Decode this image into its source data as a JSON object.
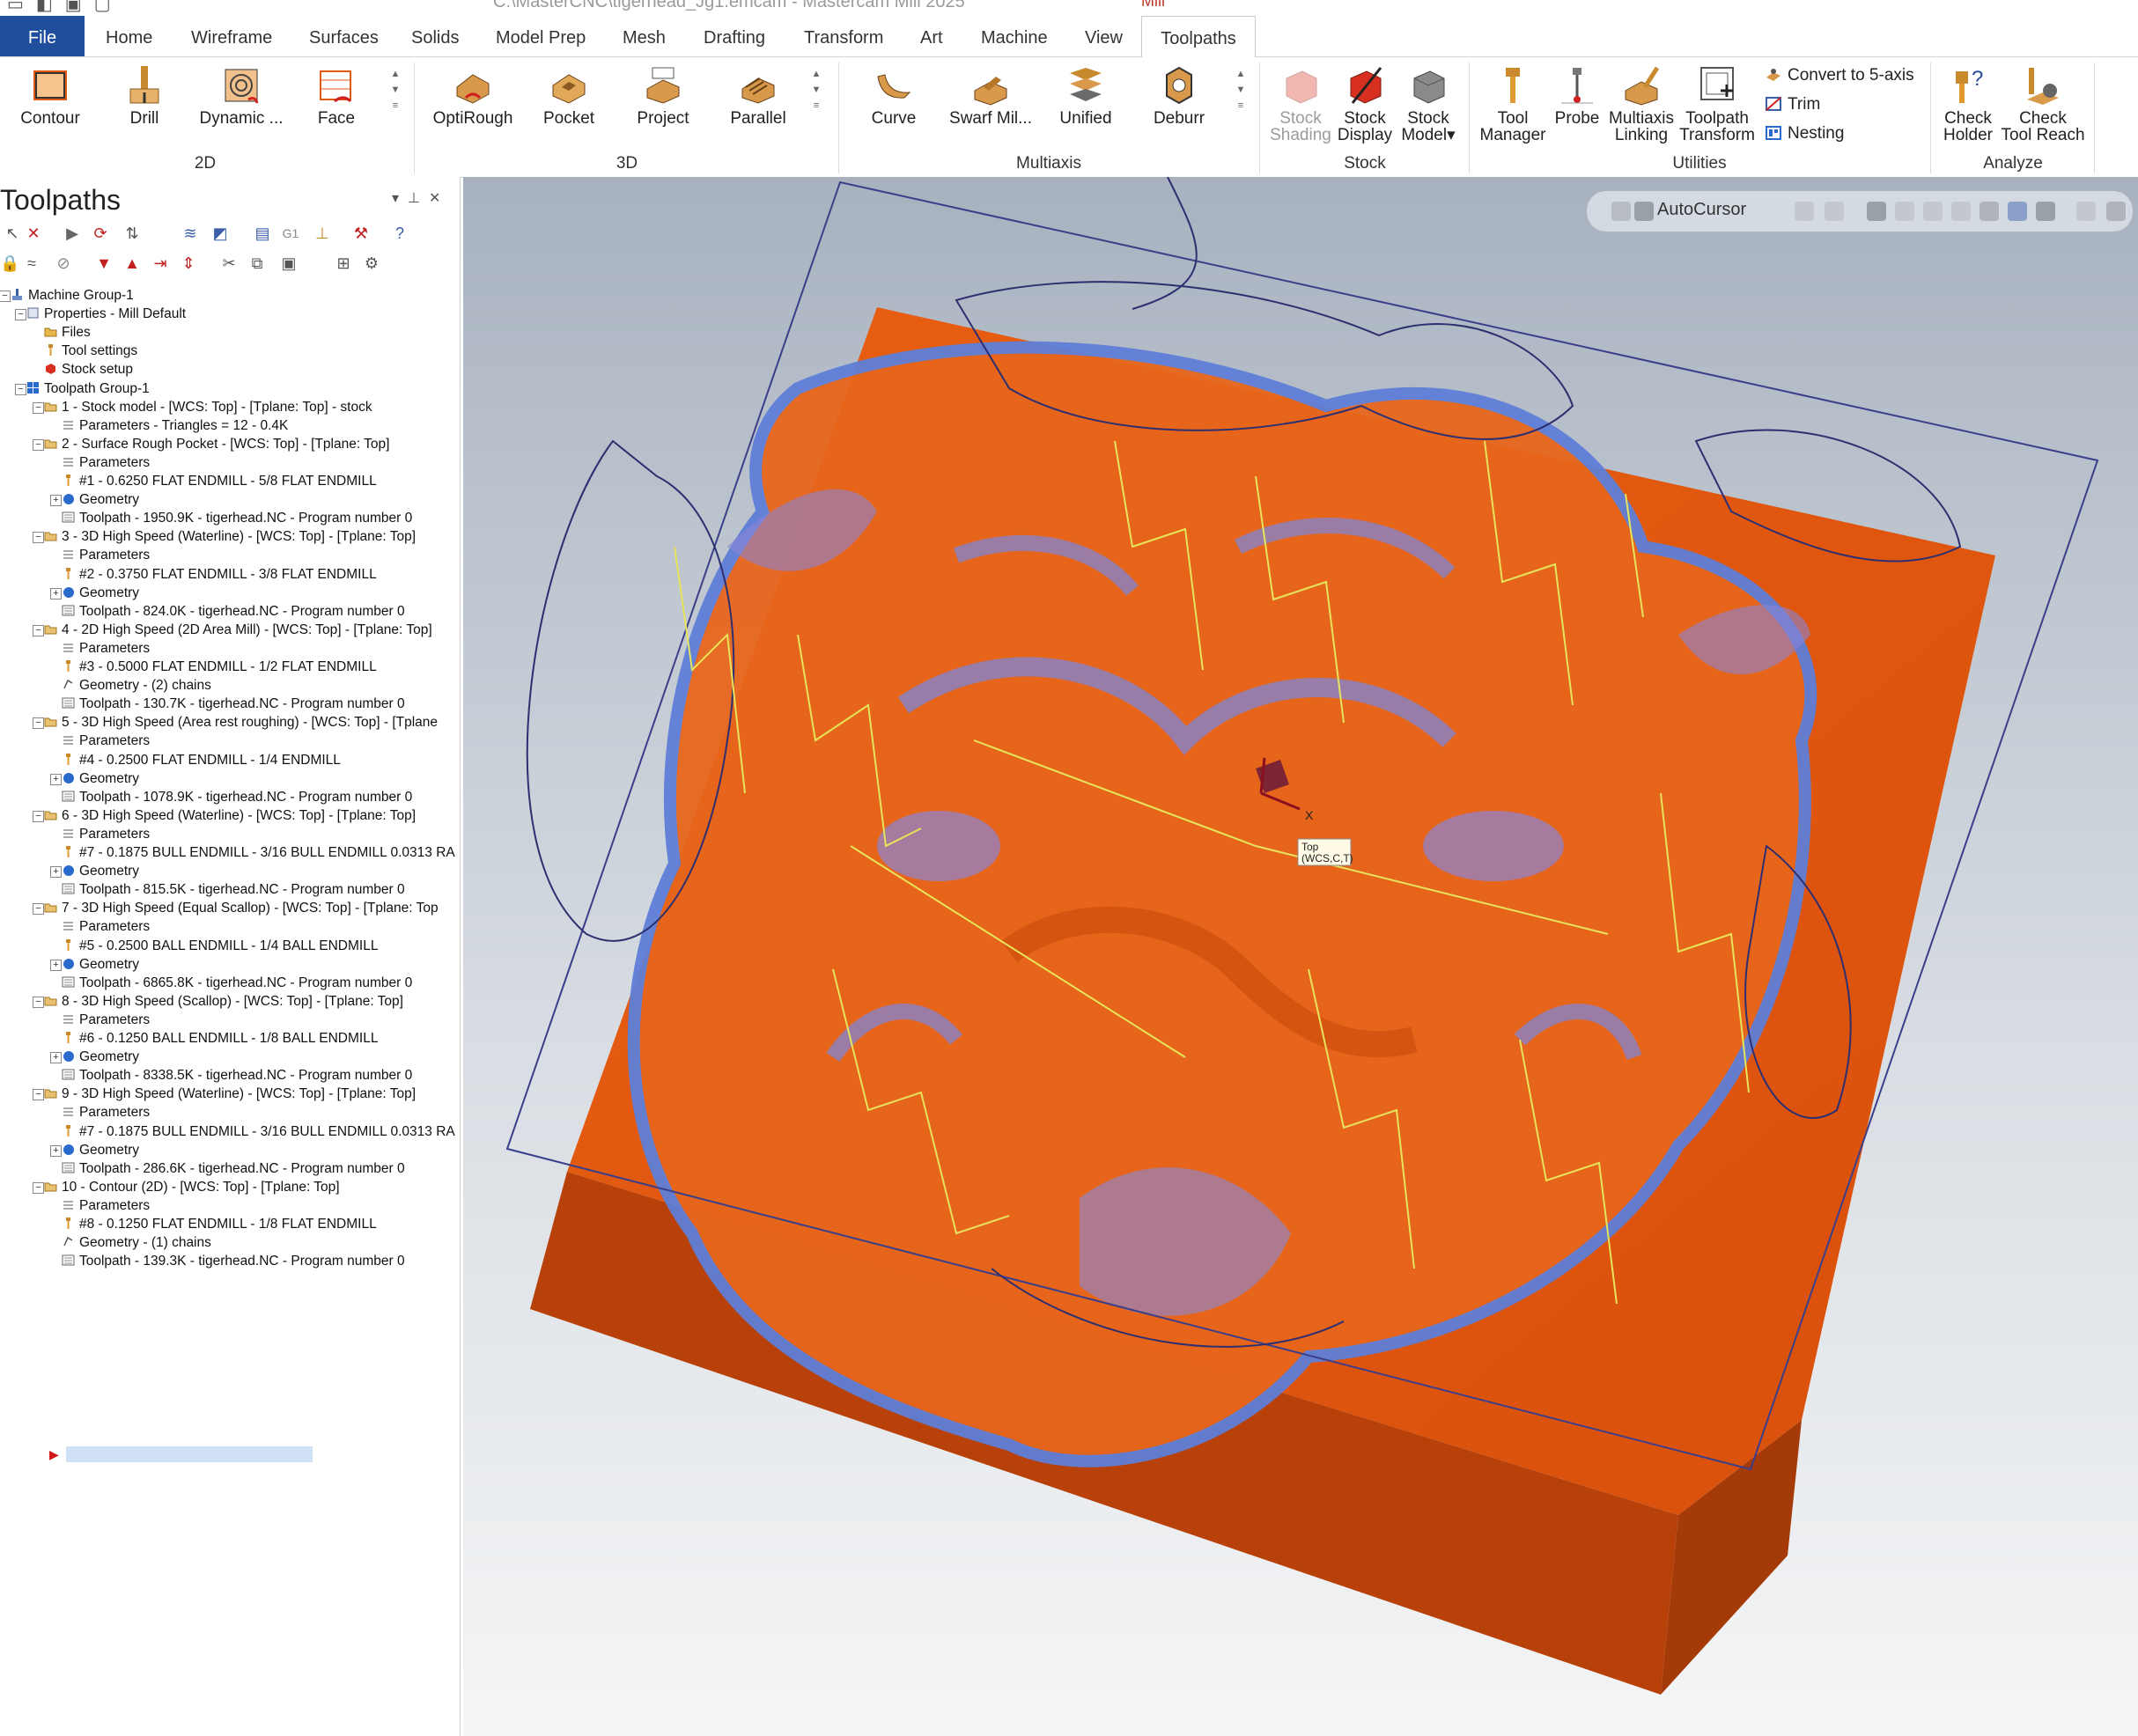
{
  "titlebar": {
    "title": "C:\\MasterCNC\\tigerhead_Jg1.emcam - Mastercam Mill 2025",
    "context_tab": "Mill"
  },
  "tabs": [
    "File",
    "Home",
    "Wireframe",
    "Surfaces",
    "Solids",
    "Model Prep",
    "Mesh",
    "Drafting",
    "Transform",
    "Art",
    "Machine",
    "View",
    "Toolpaths"
  ],
  "active_tab": "Toolpaths",
  "ribbon": {
    "groups": {
      "g2d": "2D",
      "g3d": "3D",
      "gmulti": "Multiaxis",
      "gstock": "Stock",
      "gutil": "Utilities",
      "ganalyze": "Analyze"
    },
    "b2d": [
      "Contour",
      "Drill",
      "Dynamic ...",
      "Face"
    ],
    "b3d": [
      "OptiRough",
      "Pocket",
      "Project",
      "Parallel"
    ],
    "bmulti": [
      "Curve",
      "Swarf Mil...",
      "Unified",
      "Deburr"
    ],
    "stock_shading": [
      "Stock",
      "Shading"
    ],
    "stock_display": [
      "Stock",
      "Display"
    ],
    "stock_model": [
      "Stock",
      "Model"
    ],
    "tool_manager": [
      "Tool",
      "Manager"
    ],
    "probe": "Probe",
    "multiaxis_linking": [
      "Multiaxis",
      "Linking"
    ],
    "toolpath_transform": [
      "Toolpath",
      "Transform"
    ],
    "util_small": [
      "Convert to 5-axis",
      "Trim",
      "Nesting"
    ],
    "check_holder": [
      "Check",
      "Holder"
    ],
    "check_reach": [
      "Check",
      "Tool Reach"
    ]
  },
  "panel": {
    "title": "Toolpaths",
    "tree": [
      {
        "t": "Machine Group-1",
        "lvl": 0,
        "ic": "machine"
      },
      {
        "t": "Properties - Mill Default",
        "lvl": 1,
        "ic": "props"
      },
      {
        "t": "Files",
        "lvl": 2,
        "ic": "folder"
      },
      {
        "t": "Tool settings",
        "lvl": 2,
        "ic": "tool"
      },
      {
        "t": "Stock setup",
        "lvl": 2,
        "ic": "stock"
      },
      {
        "t": "Toolpath Group-1",
        "lvl": 1,
        "ic": "group"
      },
      {
        "t": "1 - Stock model - [WCS: Top] - [Tplane: Top] - stock",
        "lvl": 2,
        "ic": "op"
      },
      {
        "t": "Parameters - Triangles =  12 - 0.4K",
        "lvl": 3,
        "ic": "params"
      },
      {
        "t": "2 - Surface Rough Pocket - [WCS: Top] - [Tplane: Top]",
        "lvl": 2,
        "ic": "op"
      },
      {
        "t": "Parameters",
        "lvl": 3,
        "ic": "params"
      },
      {
        "t": "#1 - 0.6250 FLAT ENDMILL - 5/8 FLAT ENDMILL",
        "lvl": 3,
        "ic": "tool"
      },
      {
        "t": "Geometry",
        "lvl": 3,
        "ic": "geom"
      },
      {
        "t": "Toolpath - 1950.9K - tigerhead.NC - Program number 0",
        "lvl": 3,
        "ic": "tp"
      },
      {
        "t": "3 - 3D High Speed (Waterline) - [WCS: Top] - [Tplane: Top]",
        "lvl": 2,
        "ic": "op"
      },
      {
        "t": "Parameters",
        "lvl": 3,
        "ic": "params"
      },
      {
        "t": "#2 - 0.3750 FLAT ENDMILL - 3/8 FLAT ENDMILL",
        "lvl": 3,
        "ic": "tool"
      },
      {
        "t": "Geometry",
        "lvl": 3,
        "ic": "geom"
      },
      {
        "t": "Toolpath - 824.0K - tigerhead.NC - Program number 0",
        "lvl": 3,
        "ic": "tp"
      },
      {
        "t": "4 - 2D High Speed (2D Area Mill) - [WCS: Top] - [Tplane: Top]",
        "lvl": 2,
        "ic": "op"
      },
      {
        "t": "Parameters",
        "lvl": 3,
        "ic": "params"
      },
      {
        "t": "#3 - 0.5000 FLAT ENDMILL - 1/2 FLAT ENDMILL",
        "lvl": 3,
        "ic": "tool"
      },
      {
        "t": "Geometry - (2) chains",
        "lvl": 3,
        "ic": "chain"
      },
      {
        "t": "Toolpath - 130.7K - tigerhead.NC - Program number 0",
        "lvl": 3,
        "ic": "tp"
      },
      {
        "t": "5 - 3D High Speed (Area rest roughing) - [WCS: Top] - [Tplane",
        "lvl": 2,
        "ic": "op"
      },
      {
        "t": "Parameters",
        "lvl": 3,
        "ic": "params"
      },
      {
        "t": "#4 - 0.2500 FLAT ENDMILL - 1/4 ENDMILL",
        "lvl": 3,
        "ic": "tool"
      },
      {
        "t": "Geometry",
        "lvl": 3,
        "ic": "geom"
      },
      {
        "t": "Toolpath - 1078.9K - tigerhead.NC - Program number 0",
        "lvl": 3,
        "ic": "tp"
      },
      {
        "t": "6 - 3D High Speed (Waterline) - [WCS: Top] - [Tplane: Top]",
        "lvl": 2,
        "ic": "op"
      },
      {
        "t": "Parameters",
        "lvl": 3,
        "ic": "params"
      },
      {
        "t": "#7 - 0.1875 BULL ENDMILL - 3/16 BULL ENDMILL 0.0313 RA",
        "lvl": 3,
        "ic": "tool"
      },
      {
        "t": "Geometry",
        "lvl": 3,
        "ic": "geom"
      },
      {
        "t": "Toolpath - 815.5K - tigerhead.NC - Program number 0",
        "lvl": 3,
        "ic": "tp"
      },
      {
        "t": "7 - 3D High Speed (Equal Scallop) - [WCS: Top] - [Tplane: Top",
        "lvl": 2,
        "ic": "op"
      },
      {
        "t": "Parameters",
        "lvl": 3,
        "ic": "params"
      },
      {
        "t": "#5 - 0.2500 BALL ENDMILL - 1/4 BALL ENDMILL",
        "lvl": 3,
        "ic": "tool"
      },
      {
        "t": "Geometry",
        "lvl": 3,
        "ic": "geom"
      },
      {
        "t": "Toolpath - 6865.8K - tigerhead.NC - Program number 0",
        "lvl": 3,
        "ic": "tp"
      },
      {
        "t": "8 - 3D High Speed (Scallop) - [WCS: Top] - [Tplane: Top]",
        "lvl": 2,
        "ic": "op"
      },
      {
        "t": "Parameters",
        "lvl": 3,
        "ic": "params"
      },
      {
        "t": "#6 - 0.1250 BALL ENDMILL - 1/8 BALL ENDMILL",
        "lvl": 3,
        "ic": "tool"
      },
      {
        "t": "Geometry",
        "lvl": 3,
        "ic": "geom"
      },
      {
        "t": "Toolpath - 8338.5K - tigerhead.NC - Program number 0",
        "lvl": 3,
        "ic": "tp"
      },
      {
        "t": "9 - 3D High Speed (Waterline) - [WCS: Top] - [Tplane: Top]",
        "lvl": 2,
        "ic": "op"
      },
      {
        "t": "Parameters",
        "lvl": 3,
        "ic": "params"
      },
      {
        "t": "#7 - 0.1875 BULL ENDMILL - 3/16 BULL ENDMILL 0.0313 RA",
        "lvl": 3,
        "ic": "tool"
      },
      {
        "t": "Geometry",
        "lvl": 3,
        "ic": "geom"
      },
      {
        "t": "Toolpath - 286.6K - tigerhead.NC - Program number 0",
        "lvl": 3,
        "ic": "tp"
      },
      {
        "t": "10 - Contour (2D) - [WCS: Top] - [Tplane: Top]",
        "lvl": 2,
        "ic": "op"
      },
      {
        "t": "Parameters",
        "lvl": 3,
        "ic": "params"
      },
      {
        "t": "#8 - 0.1250 FLAT ENDMILL - 1/8 FLAT ENDMILL",
        "lvl": 3,
        "ic": "tool"
      },
      {
        "t": "Geometry - (1) chains",
        "lvl": 3,
        "ic": "chain"
      },
      {
        "t": "Toolpath - 139.3K - tigerhead.NC - Program number 0",
        "lvl": 3,
        "ic": "tp"
      }
    ]
  },
  "viewport": {
    "autocursor": "AutoCursor",
    "plane_label_1": "Top",
    "plane_label_2": "(WCS,C,T)",
    "axis_x": "X"
  },
  "colors": {
    "file_tab": "#1f4e9c",
    "stock": "#e0560e",
    "toolpath_blue": "#3f7ee8",
    "link_yellow": "#e8e65a"
  }
}
